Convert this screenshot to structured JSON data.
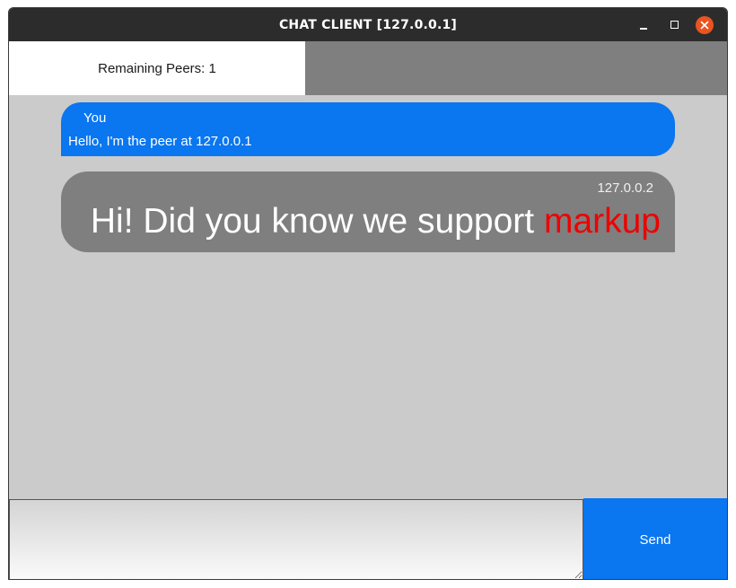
{
  "window": {
    "title": "CHAT CLIENT [127.0.0.1]",
    "controls": [
      "minimize-icon",
      "maximize-icon",
      "close-icon"
    ]
  },
  "status": {
    "remaining_peers": "Remaining Peers: 1"
  },
  "messages": [
    {
      "sender": "You",
      "text": "Hello, I'm the peer at 127.0.0.1",
      "color": "#0a76f0"
    },
    {
      "sender": "127.0.0.2",
      "text_plain": "Hi! Did you know we support ",
      "text_markup": "markup",
      "color": "#7f7f7f",
      "markup_color": "#ee0000"
    }
  ],
  "composer": {
    "input_value": "",
    "send_label": "Send"
  },
  "colors": {
    "titlebar": "#2c2c2c",
    "accent": "#0a76f0",
    "close": "#e95420",
    "background": "#cbcbcb"
  }
}
